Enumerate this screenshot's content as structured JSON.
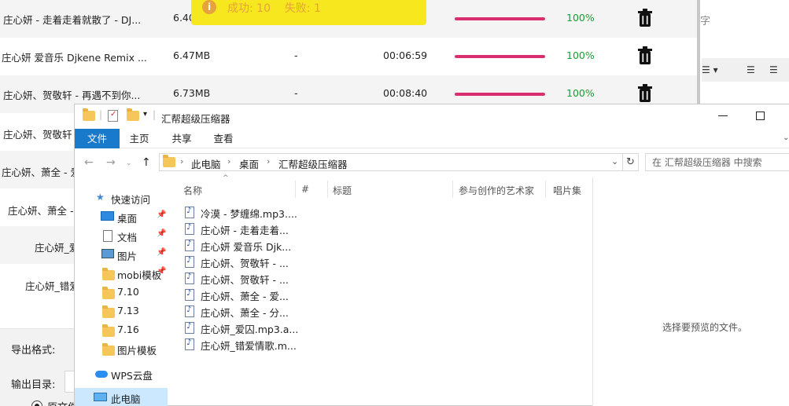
{
  "bg_app": {
    "rows": [
      {
        "name": "庄心妍 - 走着走着就散了 - DJ...",
        "size": "6.40",
        "dash": "",
        "time": "",
        "progress": 100,
        "percent": "100%"
      },
      {
        "name": "庄心妍 爱音乐 Djkene Remix ...",
        "size": "6.47MB",
        "dash": "-",
        "time": "00:06:59",
        "progress": 100,
        "percent": "100%"
      },
      {
        "name": "庄心妍、贺敬轩 - 再遇不到你...",
        "size": "6.73MB",
        "dash": "-",
        "time": "00:08:40",
        "progress": 100,
        "percent": "100%"
      }
    ],
    "partial_rows": [
      "庄心妍、贺敬轩",
      "庄心妍、萧全 - 爱",
      "庄心妍、萧全 -",
      "庄心妍_爱",
      "庄心妍_错爱"
    ],
    "export_format_label": "导出格式:",
    "output_dir_label": "输出目录:",
    "radio_label": "原文件",
    "right_strip_char": "字",
    "toast": {
      "success_label": "成功:",
      "success_count": "10",
      "fail_label": "失败:",
      "fail_count": "1"
    },
    "colors": {
      "progress": "#d8306e",
      "percent": "#1a9d33",
      "toast_bg": "#f7e71e",
      "toast_text": "#e6a23c"
    }
  },
  "explorer": {
    "title": "汇帮超级压缩器",
    "ribbon_tabs": [
      {
        "label": "文件",
        "active": true
      },
      {
        "label": "主页",
        "active": false
      },
      {
        "label": "共享",
        "active": false
      },
      {
        "label": "查看",
        "active": false
      }
    ],
    "breadcrumb": [
      "此电脑",
      "桌面",
      "汇帮超级压缩器"
    ],
    "search_placeholder": "在 汇帮超级压缩器 中搜索",
    "nav_items": [
      {
        "label": "快速访问",
        "icon": "star-icon"
      },
      {
        "label": "桌面",
        "icon": "desktop-icon",
        "pinned": true
      },
      {
        "label": "文档",
        "icon": "document-icon",
        "pinned": true
      },
      {
        "label": "图片",
        "icon": "pictures-icon",
        "pinned": true
      },
      {
        "label": "mobi模板",
        "icon": "folder-icon",
        "pinned": true
      },
      {
        "label": "7.10",
        "icon": "folder-icon"
      },
      {
        "label": "7.13",
        "icon": "folder-icon"
      },
      {
        "label": "7.16",
        "icon": "folder-icon"
      },
      {
        "label": "图片模板",
        "icon": "folder-icon"
      },
      {
        "label": "WPS云盘",
        "icon": "cloud-icon"
      },
      {
        "label": "此电脑",
        "icon": "this-pc-icon",
        "selected": true
      }
    ],
    "columns": [
      "名称",
      "#",
      "标题",
      "参与创作的艺术家",
      "唱片集"
    ],
    "files": [
      "冷漠 - 梦缠绵.mp3....",
      "庄心妍 - 走着走着...",
      "庄心妍 爱音乐 Djk...",
      "庄心妍、贺敬轩 - ...",
      "庄心妍、贺敬轩 - ...",
      "庄心妍、萧全 - 爱...",
      "庄心妍、萧全 - 分...",
      "庄心妍_爱囚.mp3.a...",
      "庄心妍_错爱情歌.m..."
    ],
    "preview_text": "选择要预览的文件。",
    "accent_color": "#1979ca"
  }
}
